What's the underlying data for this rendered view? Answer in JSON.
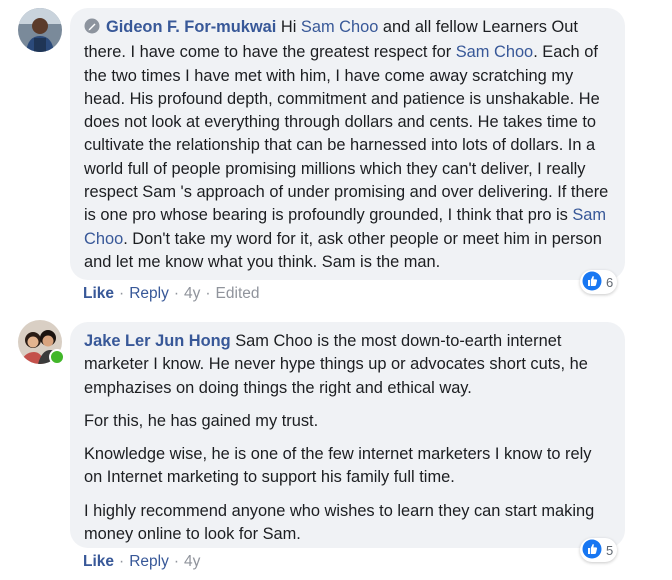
{
  "comments": [
    {
      "author": "Gideon F. For-mukwai",
      "segments": {
        "s1": "Hi ",
        "t1": "Sam Choo",
        "s2": " and all fellow Learners Out there. I have come to have the greatest respect for ",
        "t2": "Sam Choo",
        "s3": ". Each of the two times I have met with him, I have come away scratching my head. His profound depth, commitment and patience is unshakable. He does not look at everything through dollars and cents. He takes time to cultivate the relationship that can be harnessed into lots of dollars. In a world full of people promising millions which they can't deliver, I really respect Sam 's approach of under promising and over delivering. If there is one pro whose bearing is profoundly grounded, I think that pro is ",
        "t3": "Sam Choo",
        "s4": ". Don't take my word for it, ask other people or meet him in person and let me know what you think. Sam is the man."
      },
      "reaction_count": "6",
      "actions": {
        "like": "Like",
        "reply": "Reply",
        "time": "4y",
        "edited": "Edited"
      }
    },
    {
      "author": "Jake Ler Jun Hong",
      "paragraphs": [
        "Sam Choo is the most down-to-earth internet marketer I know. He never hype things up or advocates short cuts, he emphazises on doing things the right and ethical way.",
        "For this, he has gained my trust.",
        "Knowledge wise, he is one of the few internet marketers I know to rely on Internet marketing to support his family full time.",
        "I highly recommend anyone who wishes to learn they can start making money online to look for Sam."
      ],
      "reaction_count": "5",
      "actions": {
        "like": "Like",
        "reply": "Reply",
        "time": "4y"
      }
    }
  ],
  "colors": {
    "link": "#385898",
    "bubble": "#f0f2f5",
    "like_blue": "#1877f2",
    "online": "#42b72a"
  }
}
